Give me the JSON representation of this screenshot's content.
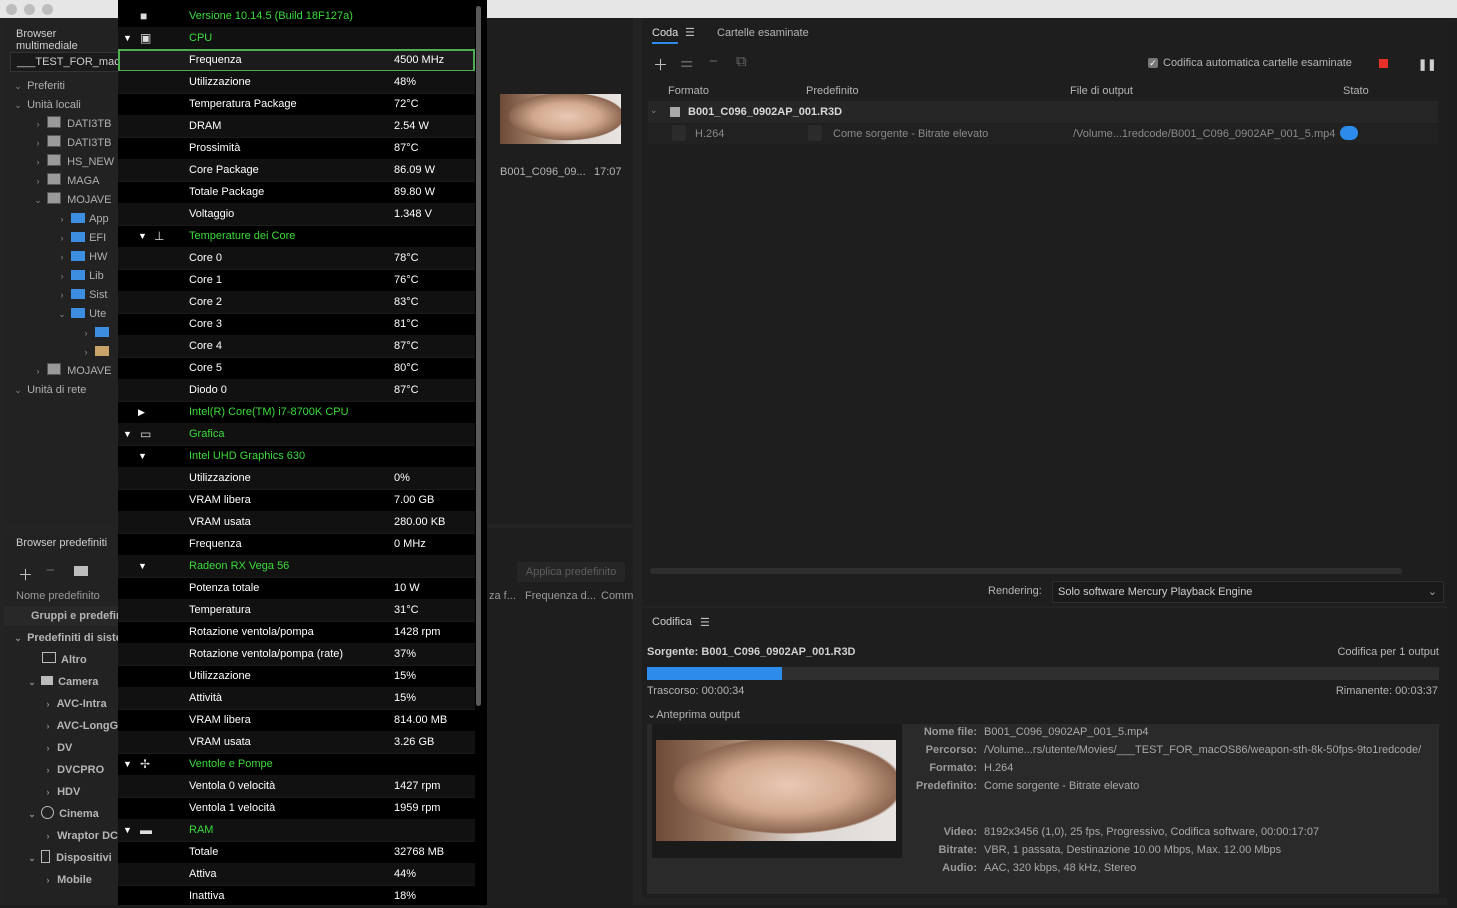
{
  "media_browser": {
    "title": "Browser multimediale",
    "path": "___TEST_FOR_macO",
    "sections": {
      "favorites": "Preferiti",
      "local": "Unità locali",
      "network": "Unità di rete"
    },
    "drives": [
      "DATI3TB",
      "DATI3TB",
      "HS_NEW",
      "MAGA",
      "MOJAVE"
    ],
    "folders": [
      "App",
      "EFI",
      "HW",
      "Lib",
      "Sist",
      "Ute"
    ],
    "drive_last": "MOJAVE"
  },
  "presets": {
    "title": "Browser predefiniti",
    "column": "Nome predefinito",
    "groups": "Gruppi e predefiniti",
    "system": "Predefiniti di sistema",
    "items": [
      "Altro",
      "Camera",
      "AVC-Intra",
      "AVC-LongG",
      "DV",
      "DVCPRO",
      "HDV",
      "Cinema",
      "Wraptor DCP",
      "Dispositivi",
      "Mobile"
    ]
  },
  "middle": {
    "thumb_name": "B001_C096_09...",
    "thumb_time": "17:07",
    "apply_preset": "Applica predefinito",
    "col_a": "za f...",
    "col_b": "Frequenza d...",
    "col_c": "Comm"
  },
  "overlay": {
    "rows": [
      {
        "k": "Versione 10.14.5 (Build 18F127a)",
        "v": "",
        "hdr": true,
        "icon": "apple-icon"
      },
      {
        "k": "CPU",
        "v": "",
        "hdr": true,
        "tri": "▼",
        "icon": "cpu-icon"
      },
      {
        "k": "Frequenza",
        "v": "4500 MHz",
        "sel": true
      },
      {
        "k": "Utilizzazione",
        "v": "48%"
      },
      {
        "k": "Temperatura Package",
        "v": "72°C"
      },
      {
        "k": "DRAM",
        "v": "2.54 W"
      },
      {
        "k": "Prossimità",
        "v": "87°C"
      },
      {
        "k": "Core Package",
        "v": "86.09 W"
      },
      {
        "k": "Totale Package",
        "v": "89.80 W"
      },
      {
        "k": "Voltaggio",
        "v": "1.348 V"
      },
      {
        "k": "Temperature dei Core",
        "v": "",
        "hdr": true,
        "tri2": "▼",
        "icon": "thermometer-icon"
      },
      {
        "k": "Core 0",
        "v": "78°C"
      },
      {
        "k": "Core 1",
        "v": "76°C"
      },
      {
        "k": "Core 2",
        "v": "83°C"
      },
      {
        "k": "Core 3",
        "v": "81°C"
      },
      {
        "k": "Core 4",
        "v": "87°C"
      },
      {
        "k": "Core 5",
        "v": "80°C"
      },
      {
        "k": "Diodo 0",
        "v": "87°C"
      },
      {
        "k": "Intel(R) Core(TM) i7-8700K CPU",
        "v": "",
        "hdr": true,
        "tri2": "▶"
      },
      {
        "k": "Grafica",
        "v": "",
        "hdr": true,
        "tri": "▼",
        "icon": "gpu-icon"
      },
      {
        "k": "Intel UHD Graphics 630",
        "v": "",
        "hdr": true,
        "tri2": "▼"
      },
      {
        "k": "Utilizzazione",
        "v": "0%"
      },
      {
        "k": "VRAM libera",
        "v": "7.00 GB"
      },
      {
        "k": "VRAM usata",
        "v": "280.00 KB"
      },
      {
        "k": "Frequenza",
        "v": "0 MHz"
      },
      {
        "k": "Radeon RX Vega 56",
        "v": "",
        "hdr": true,
        "tri2": "▼"
      },
      {
        "k": "Potenza totale",
        "v": "10 W"
      },
      {
        "k": "Temperatura",
        "v": "31°C"
      },
      {
        "k": "Rotazione ventola/pompa",
        "v": "1428 rpm"
      },
      {
        "k": "Rotazione ventola/pompa (rate)",
        "v": "37%"
      },
      {
        "k": "Utilizzazione",
        "v": "15%"
      },
      {
        "k": "Attività",
        "v": "15%"
      },
      {
        "k": "VRAM libera",
        "v": "814.00 MB"
      },
      {
        "k": "VRAM usata",
        "v": "3.26 GB"
      },
      {
        "k": "Ventole e Pompe",
        "v": "",
        "hdr": true,
        "tri": "▼",
        "icon": "fan-icon"
      },
      {
        "k": "Ventola 0 velocità",
        "v": "1427 rpm"
      },
      {
        "k": "Ventola 1 velocità",
        "v": "1959 rpm"
      },
      {
        "k": "RAM",
        "v": "",
        "hdr": true,
        "tri": "▼",
        "icon": "ram-icon"
      },
      {
        "k": "Totale",
        "v": "32768 MB"
      },
      {
        "k": "Attiva",
        "v": "44%"
      },
      {
        "k": "Inattiva",
        "v": "18%"
      }
    ]
  },
  "queue": {
    "tab_queue": "Coda",
    "tab_watch": "Cartelle esaminate",
    "auto_encode": "Codifica automatica cartelle esaminate",
    "cols": {
      "format": "Formato",
      "preset": "Predefinito",
      "output": "File di output",
      "status": "Stato"
    },
    "source": "B001_C096_0902AP_001.R3D",
    "format": "H.264",
    "preset": "Come sorgente - Bitrate elevato",
    "output": "/Volume...1redcode/B001_C096_0902AP_001_5.mp4",
    "rendering_label": "Rendering:",
    "rendering_value": "Solo software Mercury Playback Engine"
  },
  "encoding": {
    "title": "Codifica",
    "source": "Sorgente: B001_C096_0902AP_001.R3D",
    "outputs": "Codifica per 1 output",
    "elapsed": "Trascorso: 00:00:34",
    "remaining": "Rimanente: 00:03:37",
    "progress": 0.17,
    "preview_label": "Anteprima output",
    "details": [
      {
        "k": "Nome file:",
        "v": "B001_C096_0902AP_001_5.mp4"
      },
      {
        "k": "Percorso:",
        "v": "/Volume...rs/utente/Movies/___TEST_FOR_macOS86/weapon-sth-8k-50fps-9to1redcode/"
      },
      {
        "k": "Formato:",
        "v": "H.264"
      },
      {
        "k": "Predefinito:",
        "v": "Come sorgente - Bitrate elevato"
      },
      {
        "k": "Video:",
        "v": "8192x3456 (1,0), 25 fps, Progressivo, Codifica software, 00:00:17:07"
      },
      {
        "k": "Bitrate:",
        "v": "VBR, 1 passata, Destinazione 10.00 Mbps, Max. 12.00 Mbps"
      },
      {
        "k": "Audio:",
        "v": "AAC, 320 kbps, 48 kHz, Stereo"
      }
    ]
  },
  "colors": {
    "accent": "#2d8ceb",
    "stop": "#e8302a",
    "green": "#3bdc3b"
  }
}
